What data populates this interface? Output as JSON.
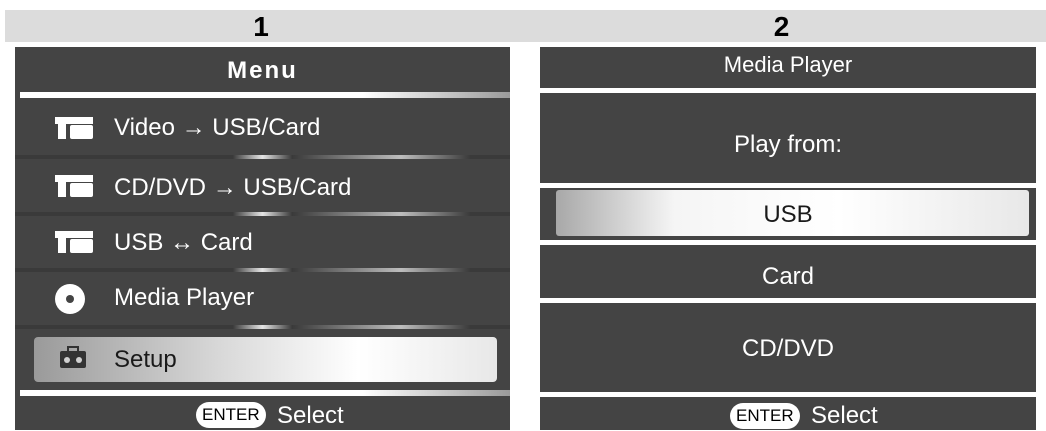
{
  "step_labels": [
    "1",
    "2"
  ],
  "panel1": {
    "title": "Menu",
    "items": [
      {
        "icon": "usb-transfer-icon",
        "label": "Video",
        "arrow": "→",
        "target": "USB/Card"
      },
      {
        "icon": "usb-transfer-icon",
        "label": "CD/DVD",
        "arrow": "→",
        "target": "USB/Card"
      },
      {
        "icon": "usb-transfer-icon",
        "label": "USB",
        "arrow": "↔",
        "target": "Card"
      },
      {
        "icon": "disc-icon",
        "label": "Media Player"
      },
      {
        "icon": "toolbox-icon",
        "label": "Setup",
        "selected": true
      }
    ],
    "footer": {
      "badge": "ENTER",
      "label": "Select"
    }
  },
  "panel2": {
    "title": "Media Player",
    "prompt": "Play from:",
    "options": [
      {
        "label": "USB",
        "selected": true
      },
      {
        "label": "Card"
      },
      {
        "label": "CD/DVD"
      }
    ],
    "footer": {
      "badge": "ENTER",
      "label": "Select"
    }
  }
}
